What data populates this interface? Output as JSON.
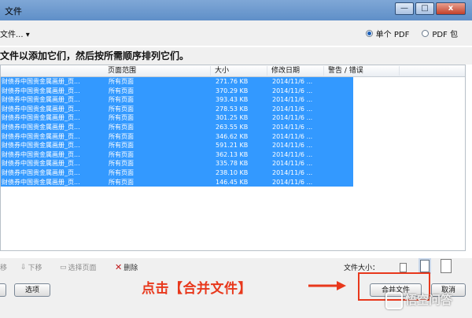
{
  "window": {
    "title": "文件",
    "buttons": [
      "—",
      "□",
      "x"
    ]
  },
  "toolbar": {
    "add_files": "文件... ▾",
    "radio_single": "单个 PDF",
    "radio_package": "PDF 包"
  },
  "instruction": "文件以添加它们，然后按所需顺序排列它们。",
  "table": {
    "headers": [
      "页面范围",
      "大小",
      "修改日期",
      "警告 / 错误"
    ],
    "rows": [
      {
        "name": "财债券中国贵金属画册_页...",
        "range": "所有页面",
        "size": "271.76 KB",
        "date": "2014/11/6 ..."
      },
      {
        "name": "财债券中国贵金属画册_页...",
        "range": "所有页面",
        "size": "370.29 KB",
        "date": "2014/11/6 ..."
      },
      {
        "name": "财债券中国贵金属画册_页...",
        "range": "所有页面",
        "size": "393.43 KB",
        "date": "2014/11/6 ..."
      },
      {
        "name": "财债券中国贵金属画册_页...",
        "range": "所有页面",
        "size": "278.53 KB",
        "date": "2014/11/6 ..."
      },
      {
        "name": "财债券中国贵金属画册_页...",
        "range": "所有页面",
        "size": "301.25 KB",
        "date": "2014/11/6 ..."
      },
      {
        "name": "财债券中国贵金属画册_页...",
        "range": "所有页面",
        "size": "263.55 KB",
        "date": "2014/11/6 ..."
      },
      {
        "name": "财债券中国贵金属画册_页...",
        "range": "所有页面",
        "size": "346.62 KB",
        "date": "2014/11/6 ..."
      },
      {
        "name": "财债券中国贵金属画册_页...",
        "range": "所有页面",
        "size": "591.21 KB",
        "date": "2014/11/6 ..."
      },
      {
        "name": "财债券中国贵金属画册_页...",
        "range": "所有页面",
        "size": "362.13 KB",
        "date": "2014/11/6 ..."
      },
      {
        "name": "财债券中国贵金属画册_页...",
        "range": "所有页面",
        "size": "335.78 KB",
        "date": "2014/11/6 ..."
      },
      {
        "name": "财债券中国贵金属画册_页...",
        "range": "所有页面",
        "size": "238.10 KB",
        "date": "2014/11/6 ..."
      },
      {
        "name": "财债券中国贵金属画册_页...",
        "range": "所有页面",
        "size": "146.45 KB",
        "date": "2014/11/6 ..."
      }
    ]
  },
  "bottombar": {
    "move_up": "移",
    "move_down": "下移",
    "select_pages": "选择页面",
    "delete": "删除",
    "file_size_label": "文件大小："
  },
  "footer": {
    "options_label": "选项",
    "merge_label": "合并文件",
    "cancel_label": "取消"
  },
  "annotation": "点击【合并文件】",
  "watermark": "悟空问答",
  "colors": {
    "selection": "#3399ff",
    "annotation": "#e8381c"
  }
}
